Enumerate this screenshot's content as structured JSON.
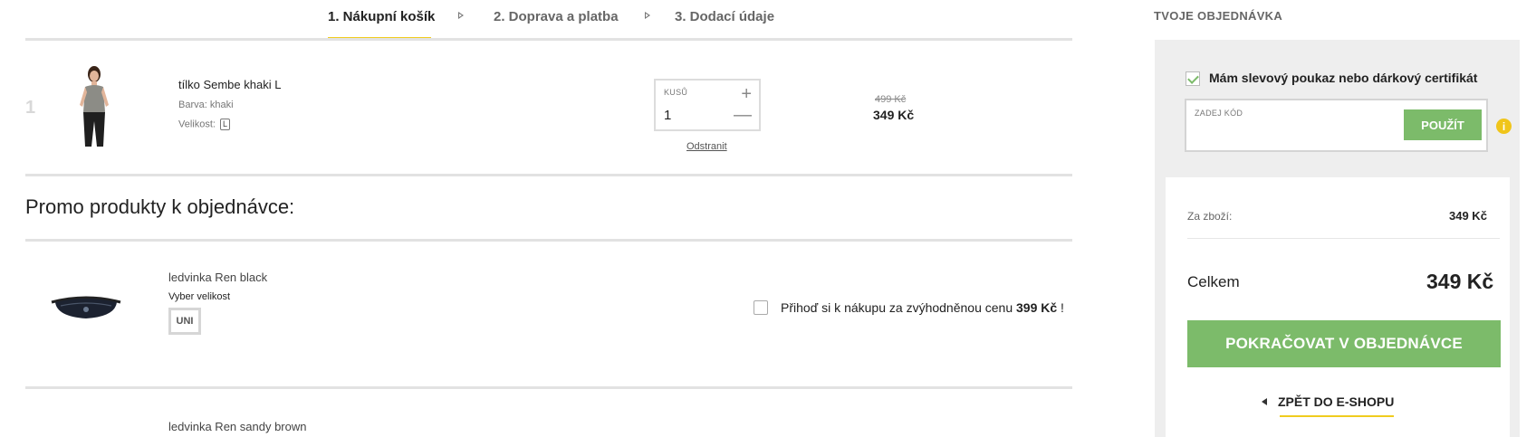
{
  "steps": [
    {
      "label": "1. Nákupní košík"
    },
    {
      "label": "2. Doprava a platba"
    },
    {
      "label": "3. Dodací údaje"
    }
  ],
  "cart": {
    "item": {
      "index": "1",
      "name": "tílko Sembe khaki L",
      "color_label": "Barva: khaki",
      "size_label": "Velikost:",
      "size": "L",
      "qty_label": "KUSŮ",
      "qty": "1",
      "remove": "Odstranit",
      "price_old": "499 Kč",
      "price_new": "349 Kč"
    }
  },
  "promo": {
    "title": "Promo produkty k objednávce:",
    "items": [
      {
        "name": "ledvinka Ren black",
        "choose_size": "Vyber velikost",
        "size": "UNI",
        "offer_text": "Přihoď si k nákupu za zvýhodněnou cenu ",
        "offer_price": "399 Kč",
        "offer_suffix": " !"
      },
      {
        "name": "ledvinka Ren sandy brown"
      }
    ]
  },
  "sidebar": {
    "title": "TVOJE OBJEDNÁVKA",
    "voucher_label": "Mám slevový poukaz nebo dárkový certifikát",
    "code_label": "ZADEJ KÓD",
    "apply": "POUŽÍT",
    "info": "i",
    "subtotal_label": "Za zboží:",
    "subtotal_value": "349 Kč",
    "total_label": "Celkem",
    "total_value": "349 Kč",
    "continue": "POKRAČOVAT V OBJEDNÁVCE",
    "back": "ZPĚT DO E-SHOPU"
  },
  "colors": {
    "accent_yellow": "#f0cc1e",
    "accent_green": "#7cbb6a"
  }
}
